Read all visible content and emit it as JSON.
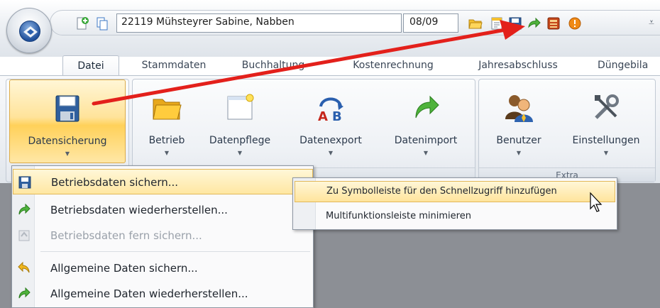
{
  "quick_access": {
    "client_value": "22119 Mühsteyrer Sabine, Nabben",
    "period_value": "08/09",
    "more_glyph": "⩡",
    "icons": [
      "new-client-icon",
      "copy-icon",
      "open-folder-icon",
      "notes-icon",
      "save-icon",
      "restore-icon",
      "calculator-icon",
      "info-icon"
    ]
  },
  "tabs": [
    {
      "label": "Datei",
      "active": true
    },
    {
      "label": "Stammdaten"
    },
    {
      "label": "Buchhaltung"
    },
    {
      "label": "Kostenrechnung"
    },
    {
      "label": "Jahresabschluss"
    },
    {
      "label": "Düngebila"
    }
  ],
  "ribbon": {
    "group1": {
      "buttons": [
        {
          "label": "Datensicherung",
          "icon": "floppy-disk-icon"
        }
      ]
    },
    "group2": {
      "label": "",
      "buttons": [
        {
          "label": "Betrieb",
          "icon": "folder-icon"
        },
        {
          "label": "Datenpflege",
          "icon": "window-icon"
        },
        {
          "label": "Datenexport",
          "icon": "export-ab-icon"
        },
        {
          "label": "Datenimport",
          "icon": "import-arrow-icon"
        }
      ]
    },
    "group3": {
      "label": "Extra",
      "buttons": [
        {
          "label": "Benutzer",
          "icon": "users-icon"
        },
        {
          "label": "Einstellungen",
          "icon": "tools-icon"
        }
      ]
    },
    "dropdown_glyph": "▼"
  },
  "menu": {
    "items": [
      {
        "label": "Betriebsdaten sichern...",
        "icon": "floppy-disk-icon",
        "highlighted": true
      },
      {
        "label": "Betriebsdaten wiederherstellen...",
        "icon": "green-arrow-icon"
      },
      {
        "label": "Betriebsdaten fern sichern...",
        "icon": "remote-save-icon",
        "disabled": true
      },
      {
        "label": "Allgemeine Daten sichern...",
        "icon": "yellow-arrow-icon"
      },
      {
        "label": "Allgemeine Daten wiederherstellen...",
        "icon": "green-arrow-icon"
      }
    ]
  },
  "context_menu": {
    "items": [
      {
        "label": "Zu Symbolleiste für den Schnellzugriff hinzufügen",
        "highlighted": true
      },
      {
        "label": "Multifunktionsleiste minimieren"
      }
    ]
  },
  "colors": {
    "highlight": "#ffe39a",
    "annotation_arrow": "#e3201b",
    "workspace": "#8c8f95"
  }
}
